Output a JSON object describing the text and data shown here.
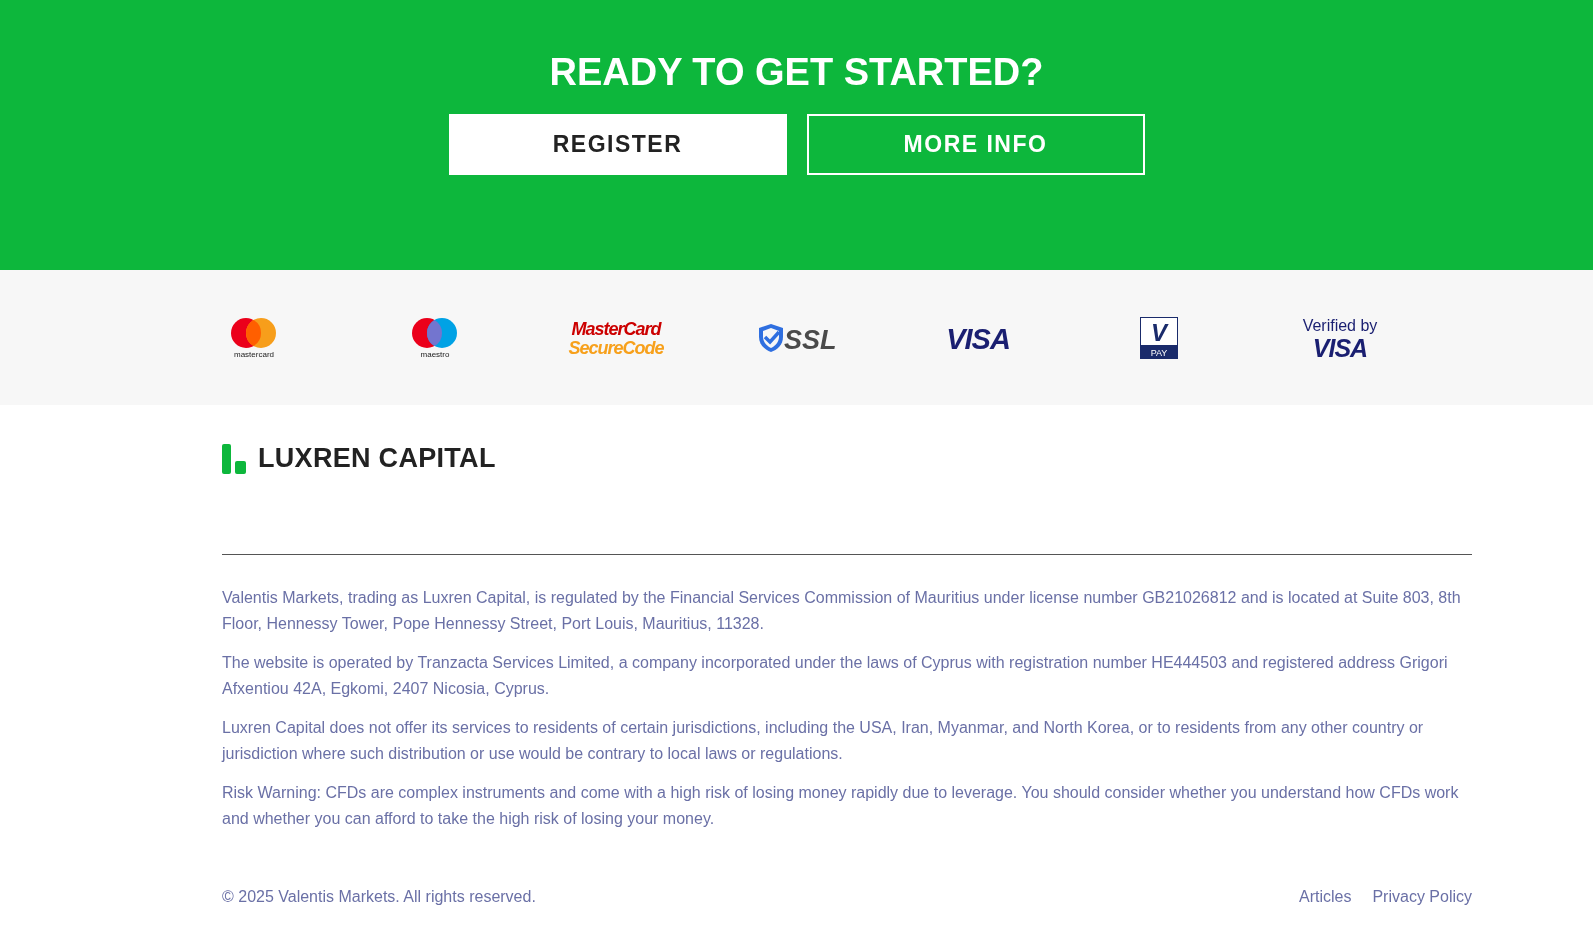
{
  "cta": {
    "heading": "READY TO GET STARTED?",
    "buttons": [
      {
        "label": "REGISTER",
        "kind": "filled"
      },
      {
        "label": "MORE INFO",
        "kind": "outline"
      }
    ]
  },
  "payment_logos": [
    {
      "kind": "mastercard",
      "texts": [
        "mastercard"
      ]
    },
    {
      "kind": "maestro",
      "texts": [
        "maestro"
      ]
    },
    {
      "kind": "securecode",
      "texts": [
        "MasterCard",
        "SecureCode"
      ]
    },
    {
      "kind": "ssl",
      "texts": [
        "SSL"
      ]
    },
    {
      "kind": "visa",
      "texts": [
        "VISA"
      ]
    },
    {
      "kind": "vpay",
      "texts": [
        "V",
        "PAY"
      ]
    },
    {
      "kind": "verified",
      "texts": [
        "Verified by",
        "VISA"
      ]
    }
  ],
  "footer": {
    "brand": "LUXREN CAPITAL",
    "paragraphs": [
      "Valentis Markets, trading as Luxren Capital, is regulated by the Financial Services Commission of Mauritius under license number GB21026812 and is located at Suite 803, 8th Floor, Hennessy Tower, Pope Hennessy Street, Port Louis, Mauritius, 11328.",
      "The website is operated by Tranzacta Services Limited, a company incorporated under the laws of Cyprus with registration number HE444503 and registered address Grigori Afxentiou 42A, Egkomi, 2407 Nicosia, Cyprus.",
      "Luxren Capital does not offer its services to residents of certain jurisdictions, including the USA, Iran, Myanmar, and North Korea, or to residents from any other country or jurisdiction where such distribution or use would be contrary to local laws or regulations.",
      "Risk Warning: CFDs are complex instruments and come with a high risk of losing money rapidly due to leverage. You should consider whether you understand how CFDs work and whether you can afford to take the high risk of losing your money."
    ],
    "copyright": "© 2025 Valentis Markets. All rights reserved.",
    "links": [
      "Articles",
      "Privacy Policy"
    ]
  }
}
